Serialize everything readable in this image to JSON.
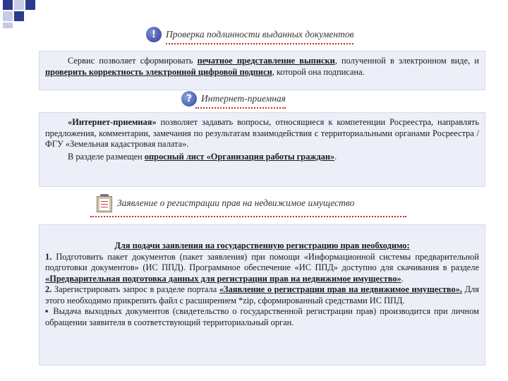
{
  "section1": {
    "heading": "Проверка подлинности выданных документов",
    "t1": "Сервис позволяет сформировать ",
    "link1": "печатное представление выписки",
    "t2": ", полученной в электронном виде, и ",
    "link2": "проверить корректность электронной цифровой подписи",
    "t3": ", которой она подписана."
  },
  "section2": {
    "heading": "Интернет-приемная",
    "bold": "«Интернет-приемная»",
    "t1": " позволяет задавать вопросы, относящиеся к компетенции Росреестра, направлять предложения, комментарии, замечания по результатам взаимодействия с территориальными органами Росреестра / ФГУ «Земельная кадастровая палата».",
    "t2": "В разделе размещен ",
    "link": "опросный лист «Организация работы граждан»",
    "t3": "."
  },
  "section3": {
    "heading": "Заявление о регистрации прав на недвижимое имущество",
    "p0": "Для подачи заявления на государственную регистрацию прав необходимо:",
    "p1_num": "1.",
    "p1_t1": " Подготовить пакет документов (пакет заявления) при помощи «Информационной системы предварительной подготовки документов» (ИС ППД). Программное обеспечение «ИС ППД» доступно для скачивания в разделе ",
    "p1_link": "«Предварительная подготовка данных для регистрации прав на недвижимое имущество»",
    "p1_t2": ".",
    "p2_num": "2.",
    "p2_t1": " Зарегистрировать запрос в разделе портала ",
    "p2_link": "«Заявление о регистрации прав на недвижимое имущество».",
    "p2_t2": " Для этого необходимо прикрепить файл с расширением *zip, сформированный средствами ИС ППД.",
    "p3_bullet": "▪",
    "p3_t": " Выдача выходных документов (свидетельство о государственной регистрации прав) производится при личном обращении заявителя в соответствующий территориальный орган."
  }
}
